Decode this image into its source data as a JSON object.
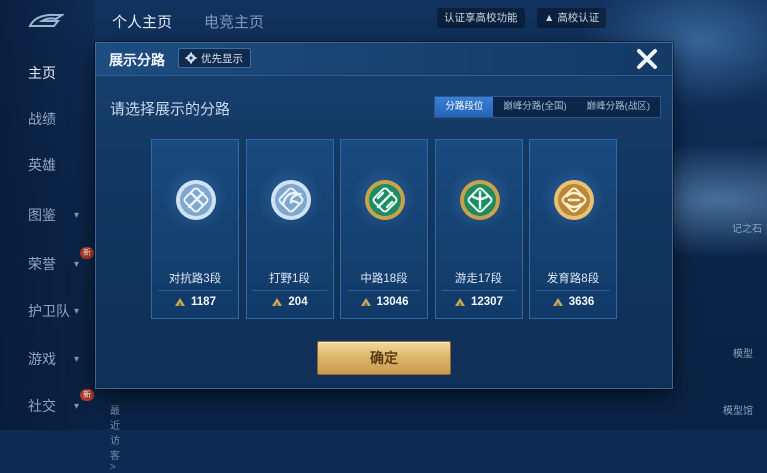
{
  "topbar": {
    "tabs": [
      {
        "label": "个人主页",
        "active": true
      },
      {
        "label": "电竞主页",
        "active": false
      }
    ],
    "pills": [
      "认证享高校功能",
      "高校认证"
    ]
  },
  "sidebar": {
    "items": [
      {
        "label": "主页",
        "active": true,
        "chevron": false,
        "badge": ""
      },
      {
        "label": "战绩",
        "active": false,
        "chevron": false,
        "badge": ""
      },
      {
        "label": "英雄",
        "active": false,
        "chevron": false,
        "badge": ""
      },
      {
        "label": "图鉴",
        "active": false,
        "chevron": true,
        "badge": ""
      },
      {
        "label": "荣誉",
        "active": false,
        "chevron": true,
        "badge": "新"
      },
      {
        "label": "护卫队",
        "active": false,
        "chevron": true,
        "badge": ""
      },
      {
        "label": "游戏",
        "active": false,
        "chevron": true,
        "badge": ""
      },
      {
        "label": "社交",
        "active": false,
        "chevron": true,
        "badge": "新"
      }
    ],
    "recent_visitors": "最近访客>"
  },
  "background": {
    "right_labels": [
      "记之石",
      "模型",
      "模型馆"
    ]
  },
  "modal": {
    "title": "展示分路",
    "priority_button": {
      "icon": "gear-icon",
      "label": "优先显示"
    },
    "close_icon": "close-icon",
    "subtitle": "请选择展示的分路",
    "segments": [
      {
        "label": "分路段位",
        "active": true
      },
      {
        "label": "巅峰分路(全国)",
        "active": false
      },
      {
        "label": "巅峰分路(战区)",
        "active": false
      }
    ],
    "lanes": [
      {
        "label": "对抗路3段",
        "score": "1187",
        "emblem": "clash-lane-emblem",
        "tier": "silver"
      },
      {
        "label": "打野1段",
        "score": "204",
        "emblem": "jungle-emblem",
        "tier": "silver"
      },
      {
        "label": "中路18段",
        "score": "13046",
        "emblem": "mid-lane-emblem",
        "tier": "jade"
      },
      {
        "label": "游走17段",
        "score": "12307",
        "emblem": "roam-emblem",
        "tier": "jade"
      },
      {
        "label": "发育路8段",
        "score": "3636",
        "emblem": "farm-lane-emblem",
        "tier": "gold"
      }
    ],
    "score_icon": "rank-score-icon",
    "confirm_label": "确定"
  },
  "colors": {
    "accent_blue": "#2e72c8",
    "gold_button": "#dcb56a",
    "card_border": "#2f6aa8"
  }
}
